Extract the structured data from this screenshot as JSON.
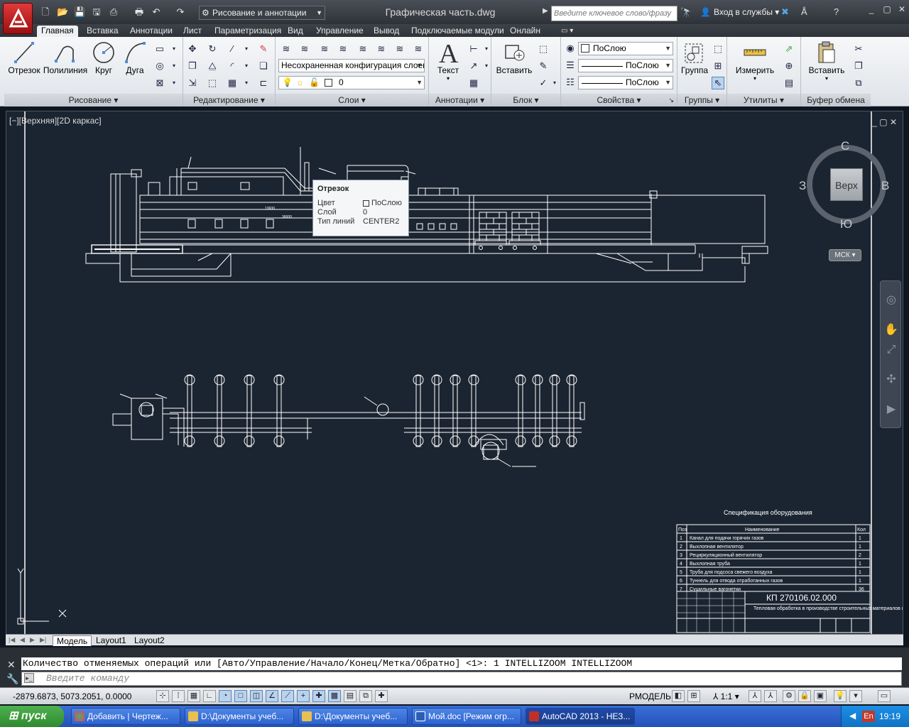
{
  "titlebar": {
    "workspace": "Рисование и аннотации",
    "document": "Графическая часть.dwg",
    "search_placeholder": "Введите ключевое слово/фразу",
    "signin": "Вход в службы"
  },
  "ribbon_tabs": [
    "Главная",
    "Вставка",
    "Аннотации",
    "Лист",
    "Параметризация",
    "Вид",
    "Управление",
    "Вывод",
    "Подключаемые модули",
    "Онлайн"
  ],
  "ribbon": {
    "draw": {
      "title": "Рисование",
      "line": "Отрезок",
      "polyline": "Полилиния",
      "circle": "Круг",
      "arc": "Дуга"
    },
    "modify": {
      "title": "Редактирование"
    },
    "layers": {
      "title": "Слои",
      "layer_state": "Несохраненная конфигурация слоев",
      "current_layer": "0"
    },
    "annotation": {
      "title": "Аннотации",
      "text": "Текст"
    },
    "block": {
      "title": "Блок",
      "insert": "Вставить"
    },
    "properties": {
      "title": "Свойства",
      "color": "ПоСлою",
      "linetype": "ПоСлою",
      "lineweight": "ПоСлою"
    },
    "groups": {
      "title": "Группы",
      "group": "Группа"
    },
    "utilities": {
      "title": "Утилиты",
      "measure": "Измерить"
    },
    "clipboard": {
      "title": "Буфер обмена",
      "paste": "Вставить"
    }
  },
  "viewport": {
    "label": "[−][Верхняя][2D каркас]",
    "viewcube": {
      "face": "Верх",
      "north": "С",
      "south": "Ю",
      "west": "З",
      "east": "В"
    },
    "wcs": "МСК"
  },
  "tooltip": {
    "title": "Отрезок",
    "rows": [
      {
        "key": "Цвет",
        "value": "ПоСлою"
      },
      {
        "key": "Слой",
        "value": "0"
      },
      {
        "key": "Тип линий",
        "value": "CENTER2"
      }
    ]
  },
  "drawing": {
    "spec_title": "Спецификация оборудования",
    "spec_header": [
      "Поз",
      "Наименование",
      "Кол"
    ],
    "spec_rows": [
      {
        "pos": "1",
        "name": "Канал для подачи горячих газов",
        "qty": "1"
      },
      {
        "pos": "2",
        "name": "Выхлопная вентилятор",
        "qty": "1"
      },
      {
        "pos": "3",
        "name": "Рециркуляционный вентилятор",
        "qty": "2"
      },
      {
        "pos": "4",
        "name": "Выхлопная труба",
        "qty": "1"
      },
      {
        "pos": "5",
        "name": "Труба для подсоса свежего воздуха",
        "qty": "1"
      },
      {
        "pos": "6",
        "name": "Туннель для отвода отработанных газов",
        "qty": "1"
      },
      {
        "pos": "7",
        "name": "Сушильные вагонетки",
        "qty": "36"
      }
    ],
    "stamp_code": "КП 270106.02.000",
    "stamp_title": "Тепловая обработка в производстве строительных материалов и изделий",
    "dim1": "13600",
    "dim2": "36000"
  },
  "layout_tabs": [
    "Модель",
    "Layout1",
    "Layout2"
  ],
  "command": {
    "history": "Количество отменяемых операций или [Авто/Управление/Начало/Конец/Метка/Обратно] <1>: 1 INTELLIZOOM INTELLIZOOM",
    "placeholder": "Введите команду"
  },
  "status": {
    "coords": "-2879.6873, 5073.2051, 0.0000",
    "model": "РМОДЕЛЬ",
    "scale": "1:1"
  },
  "taskbar": {
    "start": "пуск",
    "tasks": [
      "Добавить | Чертеж...",
      "D:\\Документы учеб...",
      "D:\\Документы учеб...",
      "Мой.doc [Режим огр...",
      "AutoCAD 2013 - НЕЗ..."
    ],
    "lang": "En",
    "clock": "19:19"
  }
}
